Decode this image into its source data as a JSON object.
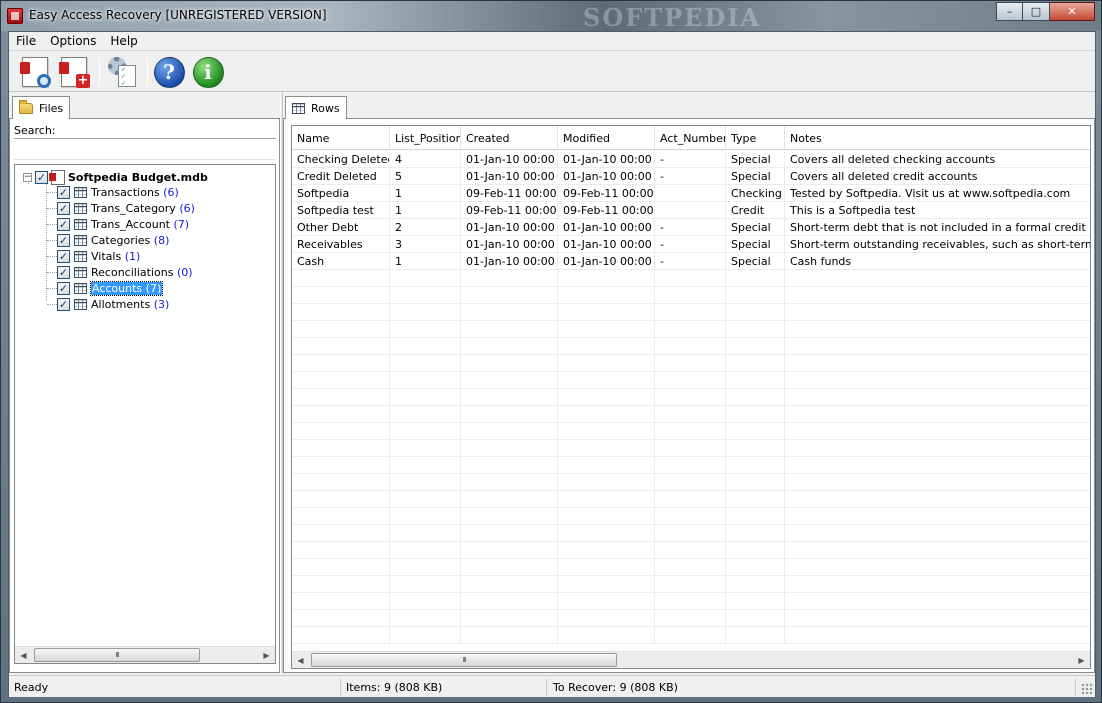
{
  "window": {
    "title": "Easy Access Recovery [UNREGISTERED VERSION]",
    "watermark": "SOFTPEDIA",
    "controls": {
      "minimize": "–",
      "maximize": "□",
      "close": "✕"
    }
  },
  "menu": [
    "File",
    "Options",
    "Help"
  ],
  "toolbar": {
    "buttons": [
      {
        "name": "open-database-button",
        "icon": "search-document-icon"
      },
      {
        "name": "recover-button",
        "icon": "add-document-icon"
      },
      {
        "name": "settings-button",
        "icon": "settings-checklist-icon"
      },
      {
        "name": "help-button",
        "icon": "question-icon",
        "glyph": "?"
      },
      {
        "name": "about-button",
        "icon": "info-icon",
        "glyph": "i"
      }
    ]
  },
  "left_panel": {
    "tab_label": "Files",
    "search_label": "Search:",
    "search_value": "",
    "tree": {
      "root": {
        "label": "Softpedia Budget.mdb",
        "expander": "−",
        "checked": "✓"
      },
      "items": [
        {
          "name": "Transactions",
          "count": "(6)"
        },
        {
          "name": "Trans_Category",
          "count": "(6)"
        },
        {
          "name": "Trans_Account",
          "count": "(7)"
        },
        {
          "name": "Categories",
          "count": "(8)"
        },
        {
          "name": "Vitals",
          "count": "(1)"
        },
        {
          "name": "Reconciliations",
          "count": "(0)"
        },
        {
          "name": "Accounts",
          "count": "(7)",
          "selected": true
        },
        {
          "name": "Allotments",
          "count": "(3)"
        }
      ]
    },
    "scroll": {
      "left": "◀",
      "right": "▶",
      "thumb": "III"
    }
  },
  "right_panel": {
    "tab_label": "Rows",
    "columns": [
      "Name",
      "List_Position",
      "Created",
      "Modified",
      "Act_Number",
      "Type",
      "Notes"
    ],
    "rows": [
      [
        "Checking Deleted",
        "4",
        "01-Jan-10 00:00",
        "01-Jan-10 00:00",
        "-",
        "Special",
        "Covers all deleted checking accounts"
      ],
      [
        "Credit Deleted",
        "5",
        "01-Jan-10 00:00",
        "01-Jan-10 00:00",
        "-",
        "Special",
        "Covers all deleted credit accounts"
      ],
      [
        "Softpedia",
        "1",
        "09-Feb-11 00:00",
        "09-Feb-11 00:00",
        "",
        "Checking",
        "Tested by Softpedia. Visit us at www.softpedia.com"
      ],
      [
        "Softpedia test",
        "1",
        "09-Feb-11 00:00",
        "09-Feb-11 00:00",
        "",
        "Credit",
        "This is a Softpedia test"
      ],
      [
        "Other Debt",
        "2",
        "01-Jan-10 00:00",
        "01-Jan-10 00:00",
        "-",
        "Special",
        "Short-term debt that is not included in a formal credit account."
      ],
      [
        "Receivables",
        "3",
        "01-Jan-10 00:00",
        "01-Jan-10 00:00",
        "-",
        "Special",
        "Short-term outstanding receivables, such as short-term loans to"
      ],
      [
        "Cash",
        "1",
        "01-Jan-10 00:00",
        "01-Jan-10 00:00",
        "-",
        "Special",
        "Cash funds"
      ]
    ],
    "scroll": {
      "left": "◀",
      "right": "▶",
      "thumb": "III"
    }
  },
  "status": {
    "state": "Ready",
    "items": "Items: 9 (808 KB)",
    "to_recover": "To Recover: 9 (808 KB)"
  }
}
